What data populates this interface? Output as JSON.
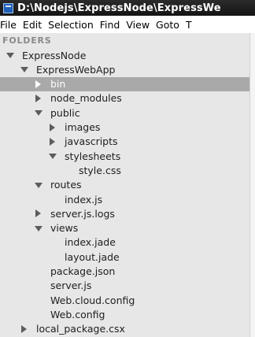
{
  "window": {
    "title": "D:\\Nodejs\\ExpressNode\\ExpressWe",
    "title_color": "#141414"
  },
  "menu": {
    "items": [
      "File",
      "Edit",
      "Selection",
      "Find",
      "View",
      "Goto",
      "T"
    ]
  },
  "sidebar": {
    "header": "FOLDERS",
    "background": "#e7e7e7",
    "selected_background": "#a9a9a9",
    "tree": [
      {
        "label": "ExpressNode",
        "type": "folder",
        "expanded": true,
        "icon": "chevron-down-icon"
      },
      {
        "label": "ExpressWebApp",
        "type": "folder",
        "expanded": true,
        "icon": "chevron-down-icon"
      },
      {
        "label": "bin",
        "type": "folder",
        "expanded": false,
        "selected": true,
        "icon": "chevron-right-icon"
      },
      {
        "label": "node_modules",
        "type": "folder",
        "expanded": false,
        "icon": "chevron-right-icon"
      },
      {
        "label": "public",
        "type": "folder",
        "expanded": true,
        "icon": "chevron-down-icon"
      },
      {
        "label": "images",
        "type": "folder",
        "expanded": false,
        "icon": "chevron-right-icon"
      },
      {
        "label": "javascripts",
        "type": "folder",
        "expanded": false,
        "icon": "chevron-right-icon"
      },
      {
        "label": "stylesheets",
        "type": "folder",
        "expanded": true,
        "icon": "chevron-down-icon"
      },
      {
        "label": "style.css",
        "type": "file"
      },
      {
        "label": "routes",
        "type": "folder",
        "expanded": true,
        "icon": "chevron-down-icon"
      },
      {
        "label": "index.js",
        "type": "file"
      },
      {
        "label": "server.js.logs",
        "type": "folder",
        "expanded": false,
        "icon": "chevron-right-icon"
      },
      {
        "label": "views",
        "type": "folder",
        "expanded": true,
        "icon": "chevron-down-icon"
      },
      {
        "label": "index.jade",
        "type": "file"
      },
      {
        "label": "layout.jade",
        "type": "file"
      },
      {
        "label": "package.json",
        "type": "file"
      },
      {
        "label": "server.js",
        "type": "file"
      },
      {
        "label": "Web.cloud.config",
        "type": "file"
      },
      {
        "label": "Web.config",
        "type": "file"
      },
      {
        "label": "local_package.csx",
        "type": "folder",
        "expanded": false,
        "icon": "chevron-right-icon"
      }
    ]
  }
}
